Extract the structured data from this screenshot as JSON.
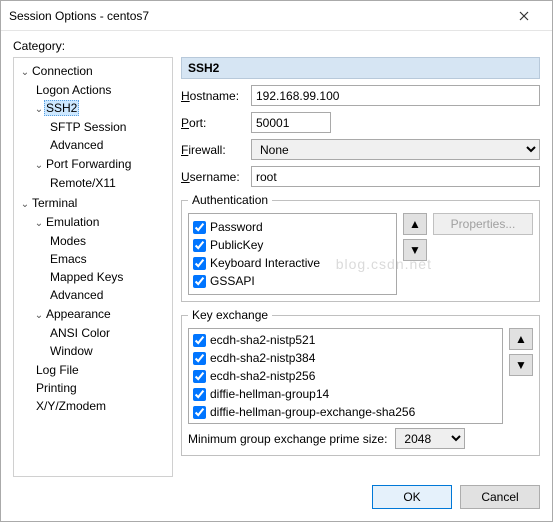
{
  "title": "Session Options - centos7",
  "categoryLabel": "Category:",
  "tree": {
    "connection": "Connection",
    "logonActions": "Logon Actions",
    "ssh2": "SSH2",
    "sftpSession": "SFTP Session",
    "advanced": "Advanced",
    "portForwarding": "Port Forwarding",
    "remoteX11": "Remote/X11",
    "terminal": "Terminal",
    "emulation": "Emulation",
    "modes": "Modes",
    "emacs": "Emacs",
    "mappedKeys": "Mapped Keys",
    "advanced2": "Advanced",
    "appearance": "Appearance",
    "ansiColor": "ANSI Color",
    "window": "Window",
    "logFile": "Log File",
    "printing": "Printing",
    "xyzModem": "X/Y/Zmodem"
  },
  "panel": {
    "heading": "SSH2",
    "hostnameLabel": "Hostname:",
    "hostname": "192.168.99.100",
    "portLabel": "Port:",
    "port": "50001",
    "firewallLabel": "Firewall:",
    "firewall": "None",
    "usernameLabel": "Username:",
    "username": "root",
    "authLegend": "Authentication",
    "authItems": [
      "Password",
      "PublicKey",
      "Keyboard Interactive",
      "GSSAPI"
    ],
    "propertiesBtn": "Properties...",
    "kexLegend": "Key exchange",
    "kexItems": [
      "ecdh-sha2-nistp521",
      "ecdh-sha2-nistp384",
      "ecdh-sha2-nistp256",
      "diffie-hellman-group14",
      "diffie-hellman-group-exchange-sha256"
    ],
    "minGroupLabel": "Minimum group exchange prime size:",
    "minGroup": "2048"
  },
  "buttons": {
    "ok": "OK",
    "cancel": "Cancel"
  },
  "watermark": "blog.csdn.net"
}
